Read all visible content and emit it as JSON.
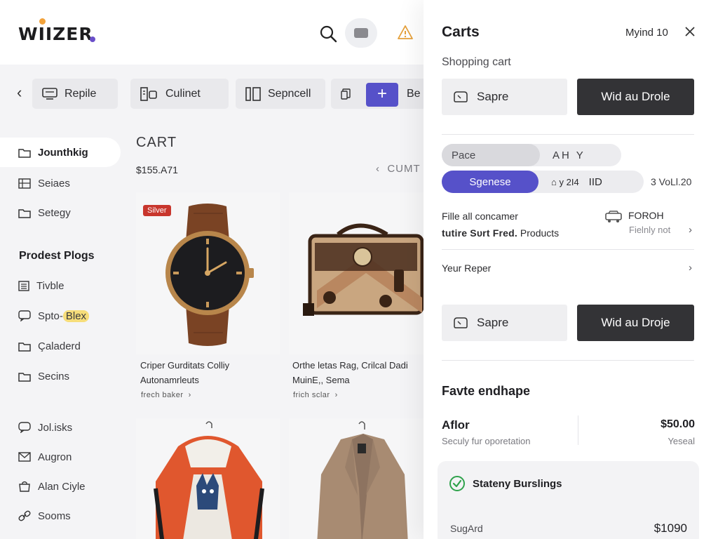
{
  "app": {
    "logo": "WIIZER",
    "colors": {
      "accent": "#5651c9",
      "dark_button": "#333336",
      "sale_tag": "#c8362d",
      "highlight": "#f6dd7a",
      "success": "#2fa24c"
    }
  },
  "chips": [
    {
      "label": "Repile",
      "icon": "monitor-icon"
    },
    {
      "label": "Culinet",
      "icon": "grid-icon"
    },
    {
      "label": "Sepncell",
      "icon": "columns-icon"
    },
    {
      "label": "Be",
      "icon": "copy-icon"
    }
  ],
  "sidebar": {
    "items": [
      {
        "label": "Jounthkig",
        "icon": "folder-icon"
      },
      {
        "label": "Seiaes",
        "icon": "grid-icon"
      },
      {
        "label": "Setegy",
        "icon": "folder-icon"
      }
    ],
    "section_title": "Prodest Plogs",
    "section_items": [
      {
        "label": "Tivble",
        "icon": "list-icon"
      },
      {
        "label": "Spto-",
        "highlight": "Blex",
        "icon": "chat-icon"
      },
      {
        "label": "Çaladerd",
        "icon": "folder-icon"
      },
      {
        "label": "Secins",
        "icon": "folder-icon"
      }
    ],
    "footer_items": [
      {
        "label": "Jol.isks",
        "icon": "chat-icon"
      },
      {
        "label": "Augron",
        "icon": "mail-icon"
      },
      {
        "label": "Alan Ciyle",
        "icon": "bag-icon"
      },
      {
        "label": "Sooms",
        "icon": "link-icon"
      }
    ]
  },
  "main": {
    "title": "CART",
    "total": "$155.A71",
    "pager": "CUMT",
    "products": [
      {
        "tag": "Silver",
        "name_line1": "Criper Gurditats Colliy",
        "name_line2": "Autonamrleuts",
        "link": "frech baker"
      },
      {
        "name_line1": "Orthe letas Rag, Crilcal Dadi",
        "name_line2": "MuinE,, Sema",
        "link": "frich sclar"
      }
    ]
  },
  "drawer": {
    "title": "Carts",
    "user": "Myind 10",
    "subtitle": "Shopping cart",
    "save_label": "Sapre",
    "primary_label_1": "Wid au Drole",
    "primary_label_2": "Wid au Droje",
    "pace_label": "Pace",
    "pace_options": "AH   Y",
    "segment_active": "Sgenese",
    "segment_mid": "y  2Ι4",
    "segment_end": "ΙΙD",
    "segment_side": "3 VoLl.20",
    "info_line1": "Fille all concamer",
    "info_line2_strong": "tutire Sυrt Fred.",
    "info_line2_rest": " Products",
    "delivery_title": "FOROH",
    "delivery_sub": "Fielnly not",
    "your_report": "Yeur Reper",
    "fav_title": "Favte endhape",
    "plan_name": "Aflor",
    "plan_desc": "Seculy fur oporetation",
    "plan_price": "$50.00",
    "plan_period": "Yeseal",
    "status": "Stateny Burslings",
    "subtotal_label": "SugArd",
    "subtotal_value": "$1090"
  }
}
